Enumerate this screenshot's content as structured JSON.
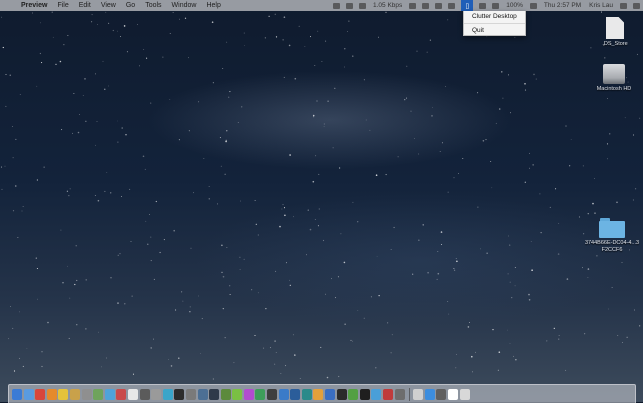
{
  "menubar": {
    "apple_glyph": "",
    "menus": [
      "Preview",
      "File",
      "Edit",
      "View",
      "Go",
      "Tools",
      "Window",
      "Help"
    ],
    "status": {
      "network_speed": "1.05 Kbps",
      "battery_label": "100%",
      "clock": "Thu 2:57 PM",
      "user": "Kris Lau"
    }
  },
  "dropdown": {
    "items": [
      "Clutter Desktop",
      "Quit"
    ]
  },
  "desktop_icons": [
    {
      "name": ".DS_Store",
      "icon": "document-icon"
    },
    {
      "name": "Macintosh HD",
      "icon": "hard-drive-icon"
    },
    {
      "name": "3744B66E-DC04-4...3F2CCF6",
      "icon": "folder-icon"
    }
  ],
  "dock": {
    "colors": [
      "#3a7bd5",
      "#5a9be0",
      "#d9463b",
      "#e58a2c",
      "#e4c23b",
      "#c9a14a",
      "#8f8f8f",
      "#6fa35c",
      "#4fa3d9",
      "#c94a4a",
      "#e8e8e8",
      "#5b5b5b",
      "#9a9a9a",
      "#3aa5c9",
      "#2c2c2c",
      "#7a7a7a",
      "#4c6f94",
      "#2f3a4a",
      "#5c8a3c",
      "#7ac043",
      "#b24ccf",
      "#3e9d5a",
      "#3e3e3e",
      "#3a7bc8",
      "#2b5d9a",
      "#2a8a8a",
      "#e3a03b",
      "#3a6ec2",
      "#2b2b2b",
      "#53a043",
      "#1f1f1f",
      "#4a9fd8",
      "#c03b3b",
      "#6d6d6d",
      "#d0d0d0",
      "#3c8dde",
      "#5f5f5f",
      "#ffffff",
      "#d8d8d8"
    ]
  }
}
